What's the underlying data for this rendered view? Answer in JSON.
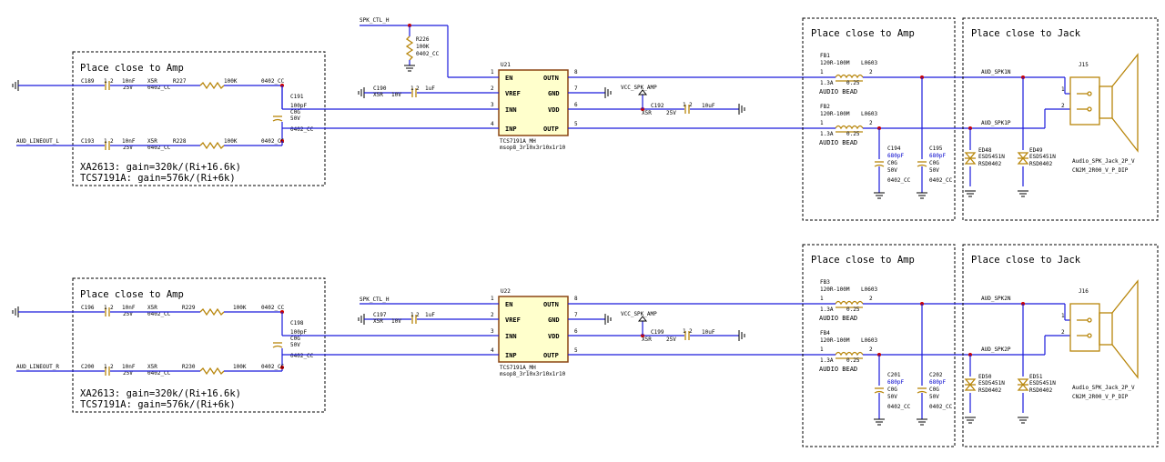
{
  "notes": {
    "place_amp": "Place close to Amp",
    "place_jack": "Place close to Jack",
    "gain1": "XA2613: gain=320k/(Ri+16.6k)",
    "gain2": "TCS7191A: gain=576k/(Ri+6k)"
  },
  "channel1": {
    "in_net": "AUD_LINEOUT_L",
    "c_in_a": {
      "ref": "C189",
      "val": "10nF",
      "v": "25V",
      "d": "X5R",
      "fp": "0402_CC"
    },
    "c_in_b": {
      "ref": "C193",
      "val": "10nF",
      "v": "25V",
      "d": "X5R",
      "fp": "0402_CC"
    },
    "r_a": {
      "ref": "R227",
      "val": "100K"
    },
    "r_b": {
      "ref": "R228",
      "val": "100K"
    },
    "r_fp": "0402_CC",
    "c_diff": {
      "ref": "C191",
      "val": "100pF",
      "d": "C0G",
      "v": "50V",
      "fp": "0402_CC"
    },
    "ctl_net": "SPK_CTL_H",
    "r_pull": {
      "ref": "R226",
      "val": "100K",
      "fp": "0402_CC"
    },
    "c_vref": {
      "ref": "C190",
      "d": "X5R",
      "v": "10V",
      "val": "1uF"
    },
    "c_vdd": {
      "ref": "C192",
      "d": "X5R",
      "v": "25V",
      "val": "10uF"
    },
    "vcc": "VCC_SPK_AMP",
    "ic": {
      "ref": "U21",
      "part": "TCS7191A_MH",
      "pkg": "msop8_3r10x3r10x1r10"
    },
    "fb_a": {
      "ref": "FB1",
      "val": "120R-100M",
      "fp": "L0603",
      "rating": "1.3A",
      "dcr": "0.25",
      "label": "AUDIO BEAD"
    },
    "fb_b": {
      "ref": "FB2",
      "val": "120R-100M",
      "fp": "L0603",
      "rating": "1.3A",
      "dcr": "0.25",
      "label": "AUDIO BEAD"
    },
    "c_out_a": {
      "ref": "C194",
      "val": "680pF",
      "d": "C0G",
      "v": "50V",
      "fp": "0402_CC"
    },
    "c_out_b": {
      "ref": "C195",
      "val": "680pF",
      "d": "C0G",
      "v": "50V",
      "fp": "0402_CC"
    },
    "net_n": "AUD_SPK1N",
    "net_p": "AUD_SPK1P",
    "esd_a": {
      "ref": "ED48",
      "part": "ESD5451N",
      "fp": "RSD0402"
    },
    "esd_b": {
      "ref": "ED49",
      "part": "ESD5451N",
      "fp": "RSD0402"
    },
    "jack": {
      "ref": "J15",
      "part": "Audio_SPK_Jack_2P_V",
      "fp": "CN2M_2R00_V_P_DIP"
    }
  },
  "channel2": {
    "in_net": "AUD_LINEOUT_R",
    "c_in_a": {
      "ref": "C196",
      "val": "10nF",
      "v": "25V",
      "d": "X5R",
      "fp": "0402_CC"
    },
    "c_in_b": {
      "ref": "C200",
      "val": "10nF",
      "v": "25V",
      "d": "X5R",
      "fp": "0402_CC"
    },
    "r_a": {
      "ref": "R229",
      "val": "100K"
    },
    "r_b": {
      "ref": "R230",
      "val": "100K"
    },
    "r_fp": "0402_CC",
    "c_diff": {
      "ref": "C198",
      "val": "100pF",
      "d": "C0G",
      "v": "50V",
      "fp": "0402_CC"
    },
    "ctl_net": "SPK_CTL_H",
    "c_vref": {
      "ref": "C197",
      "d": "X5R",
      "v": "10V",
      "val": "1uF"
    },
    "c_vdd": {
      "ref": "C199",
      "d": "X5R",
      "v": "25V",
      "val": "10uF"
    },
    "vcc": "VCC_SPK_AMP",
    "ic": {
      "ref": "U22",
      "part": "TCS7191A_MH",
      "pkg": "msop8_3r10x3r10x1r10"
    },
    "fb_a": {
      "ref": "FB3",
      "val": "120R-100M",
      "fp": "L0603",
      "rating": "1.3A",
      "dcr": "0.25",
      "label": "AUDIO BEAD"
    },
    "fb_b": {
      "ref": "FB4",
      "val": "120R-100M",
      "fp": "L0603",
      "rating": "1.3A",
      "dcr": "0.25",
      "label": "AUDIO BEAD"
    },
    "c_out_a": {
      "ref": "C201",
      "val": "680pF",
      "d": "C0G",
      "v": "50V",
      "fp": "0402_CC"
    },
    "c_out_b": {
      "ref": "C202",
      "val": "680pF",
      "d": "C0G",
      "v": "50V",
      "fp": "0402_CC"
    },
    "net_n": "AUD_SPK2N",
    "net_p": "AUD_SPK2P",
    "esd_a": {
      "ref": "ED50",
      "part": "ESD5451N",
      "fp": "RSD0402"
    },
    "esd_b": {
      "ref": "ED51",
      "part": "ESD5451N",
      "fp": "RSD0402"
    },
    "jack": {
      "ref": "J16",
      "part": "Audio_SPK_Jack_2P_V",
      "fp": "CN2M_2R00_V_P_DIP"
    }
  },
  "ic_pins": {
    "left": [
      {
        "num": "1",
        "name": "EN"
      },
      {
        "num": "2",
        "name": "VREF"
      },
      {
        "num": "3",
        "name": "INN"
      },
      {
        "num": "4",
        "name": "INP"
      }
    ],
    "right": [
      {
        "num": "8",
        "name": "OUTN"
      },
      {
        "num": "7",
        "name": "GND"
      },
      {
        "num": "6",
        "name": "VDD"
      },
      {
        "num": "5",
        "name": "OUTP"
      }
    ]
  },
  "pin_numbers": {
    "one": "1",
    "two": "2"
  },
  "colors": {
    "wire": "#1a1adc",
    "junction": "#cc0000",
    "ic_fill": "#ffffcc",
    "jack": "#b8860b"
  }
}
